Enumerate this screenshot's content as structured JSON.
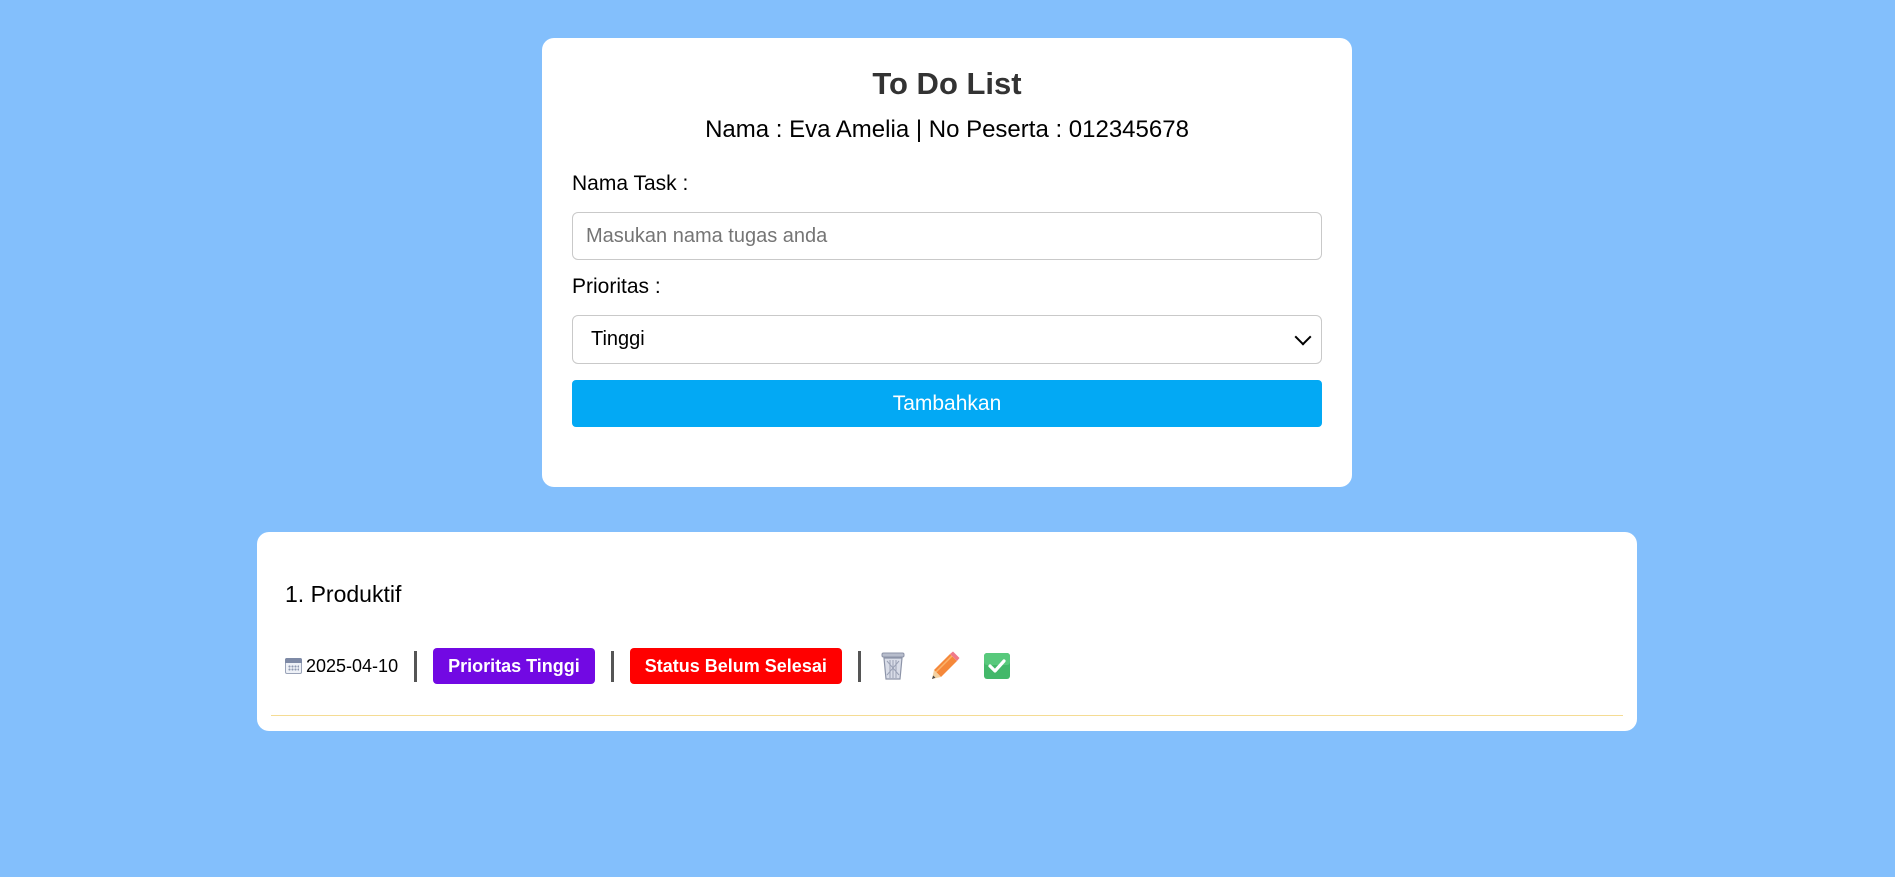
{
  "app": {
    "title": "To Do List",
    "subtitle": "Nama : Eva Amelia | No Peserta : 012345678"
  },
  "form": {
    "task_label": "Nama Task :",
    "task_placeholder": "Masukan nama tugas anda",
    "task_value": "",
    "priority_label": "Prioritas :",
    "priority_selected": "Tinggi",
    "add_button_label": "Tambahkan"
  },
  "tasks": [
    {
      "title": "1. Produktif",
      "date_icon": "calendar-icon",
      "date": "2025-04-10",
      "priority_badge": "Prioritas Tinggi",
      "status_badge": "Status Belum Selesai",
      "actions": [
        "trash-icon",
        "pencil-icon",
        "check-icon"
      ]
    }
  ],
  "colors": {
    "background": "#83bffc",
    "card": "#ffffff",
    "title_text": "#333333",
    "add_button": "#03a9f4",
    "priority_badge": "#7209e3",
    "status_badge": "#ff0000",
    "item_divider": "#f5dc94"
  }
}
